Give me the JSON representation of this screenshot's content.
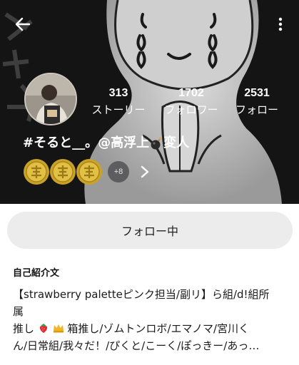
{
  "header": {
    "back_icon": "arrow-left-icon",
    "menu_icon": "more-vertical-icon"
  },
  "stats": [
    {
      "count": "313",
      "label": "ストーリー"
    },
    {
      "count": "1702",
      "label": "フォロワー"
    },
    {
      "count": "2531",
      "label": "フォロー"
    }
  ],
  "profile": {
    "name_part1": "#そると__。@高浮上",
    "name_part2": "変人",
    "badge_icon": "gold-coin-badge-icon",
    "badge_overflow": "+8"
  },
  "follow_button": {
    "label": "フォロー中"
  },
  "bio": {
    "title": "自己紹介文",
    "line1": "【strawberry paletteピンク担当/副リ】ら組/d!組所",
    "line2": "属",
    "line3_pre": "推し",
    "line3_post": "箱推し/ゾムトンロボ/エマノマ/宮川く",
    "line4": "ん/日常組/我々だ！/ぴくと/こーく/ぽっきー/あっ…"
  },
  "colors": {
    "cover_bg": "#141414",
    "follow_bg": "#ececec",
    "coin_gold": "#c9a227",
    "text": "#1a1a1a"
  }
}
